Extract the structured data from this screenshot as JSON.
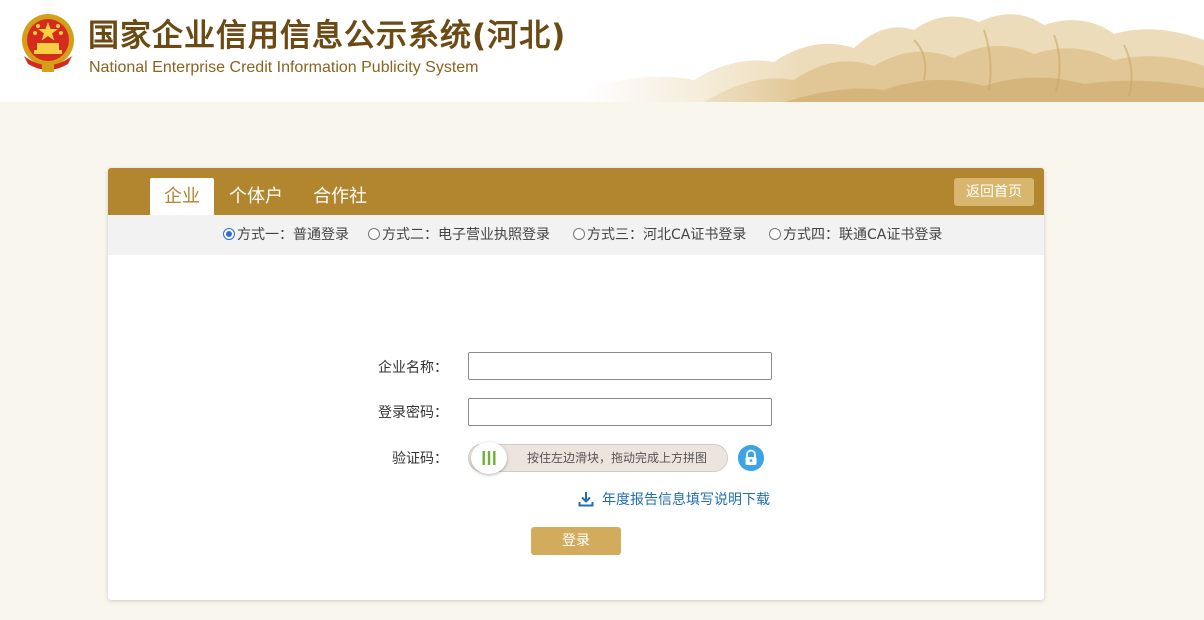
{
  "header": {
    "title_cn": "国家企业信用信息公示系统(河北)",
    "title_en": "National Enterprise Credit Information Publicity System"
  },
  "tabs": [
    {
      "label": "企业",
      "active": true
    },
    {
      "label": "个体户",
      "active": false
    },
    {
      "label": "合作社",
      "active": false
    }
  ],
  "home_button": "返回首页",
  "login_methods": [
    {
      "label": "方式一：普通登录",
      "checked": true
    },
    {
      "label": "方式二：电子营业执照登录",
      "checked": false
    },
    {
      "label": "方式三：河北CA证书登录",
      "checked": false
    },
    {
      "label": "方式四：联通CA证书登录",
      "checked": false
    }
  ],
  "form": {
    "company_label": "企业名称：",
    "company_value": "",
    "password_label": "登录密码：",
    "password_value": "",
    "captcha_label": "验证码：",
    "slider_hint": "按住左边滑块，拖动完成上方拼图"
  },
  "download_link": "年度报告信息填写说明下载",
  "login_button": "登录",
  "colors": {
    "brand_gold": "#b1862e",
    "button_gold": "#d2ac5c",
    "home_button": "#d9b66e",
    "title_brown": "#6b4a14",
    "link_blue": "#1f6fb5",
    "lock_blue": "#3aa4e6",
    "slider_green": "#6bb13a"
  },
  "icons": {
    "emblem": "national-emblem-icon",
    "lock": "lock-icon",
    "download": "download-icon",
    "slider_handle": "slider-grip-icon"
  }
}
